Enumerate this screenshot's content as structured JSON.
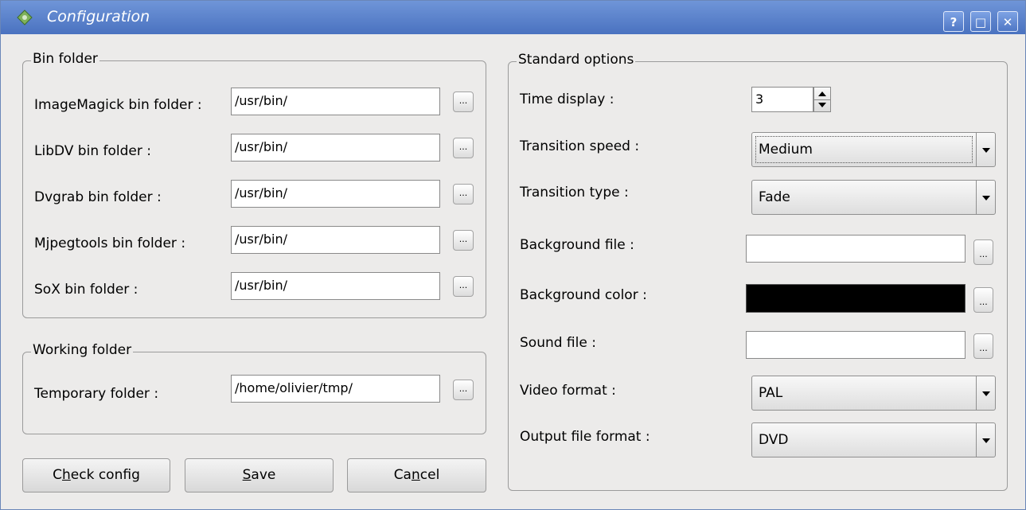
{
  "window": {
    "title": "Configuration",
    "help_label": "?",
    "maximize_label": "□",
    "close_label": "✕"
  },
  "bin_folder": {
    "legend": "Bin folder",
    "rows": [
      {
        "label": "ImageMagick bin folder :",
        "value": "/usr/bin/",
        "browse": "..."
      },
      {
        "label": "LibDV bin folder :",
        "value": "/usr/bin/",
        "browse": "..."
      },
      {
        "label": "Dvgrab bin folder :",
        "value": "/usr/bin/",
        "browse": "..."
      },
      {
        "label": "Mjpegtools bin folder :",
        "value": "/usr/bin/",
        "browse": "..."
      },
      {
        "label": "SoX bin folder :",
        "value": "/usr/bin/",
        "browse": "..."
      }
    ]
  },
  "working_folder": {
    "legend": "Working folder",
    "rows": [
      {
        "label": "Temporary folder :",
        "value": "/home/olivier/tmp/",
        "browse": "..."
      }
    ]
  },
  "standard_options": {
    "legend": "Standard options",
    "time_display": {
      "label": "Time display :",
      "value": "3"
    },
    "transition_speed": {
      "label": "Transition speed :",
      "value": "Medium"
    },
    "transition_type": {
      "label": "Transition type :",
      "value": "Fade"
    },
    "background_file": {
      "label": "Background file :",
      "value": "",
      "browse": "..."
    },
    "background_color": {
      "label": "Background color :",
      "color": "#000000",
      "browse": "..."
    },
    "sound_file": {
      "label": "Sound file :",
      "value": "",
      "browse": "..."
    },
    "video_format": {
      "label": "Video format :",
      "value": "PAL"
    },
    "output_file_format": {
      "label": "Output file format :",
      "value": "DVD"
    }
  },
  "buttons": {
    "check_config": {
      "pre": "C",
      "mnemonic": "h",
      "post": "eck config"
    },
    "save": {
      "pre": "",
      "mnemonic": "S",
      "post": "ave"
    },
    "cancel": {
      "pre": "Ca",
      "mnemonic": "n",
      "post": "cel"
    }
  },
  "colors": {
    "titlebar": "#4a72c0",
    "window_bg": "#ecebea"
  }
}
